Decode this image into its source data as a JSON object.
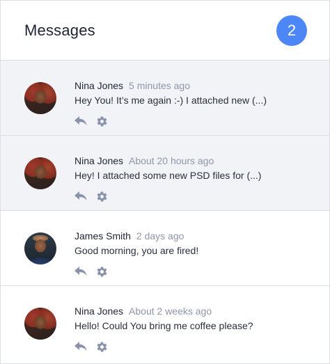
{
  "header": {
    "title": "Messages",
    "unread_count": "2"
  },
  "colors": {
    "badge": "#4d86f7",
    "unread_row": "#f1f3f7",
    "icon": "#8a93aa"
  },
  "messages": [
    {
      "sender": "Nina Jones",
      "time": "5 minutes ago",
      "text": "Hey You! It’s me again :-) I attached new (...)",
      "unread": true,
      "avatar": "nina"
    },
    {
      "sender": "Nina Jones",
      "time": "About 20 hours ago",
      "text": "Hey! I attached some new PSD files for (...)",
      "unread": true,
      "avatar": "nina"
    },
    {
      "sender": "James Smith",
      "time": "2 days ago",
      "text": "Good morning, you are fired!",
      "unread": false,
      "avatar": "james"
    },
    {
      "sender": "Nina Jones",
      "time": "About 2 weeks ago",
      "text": "Hello! Could You bring me coffee please?",
      "unread": false,
      "avatar": "nina"
    }
  ],
  "icons": {
    "reply": "reply-icon",
    "settings": "gear-icon"
  }
}
